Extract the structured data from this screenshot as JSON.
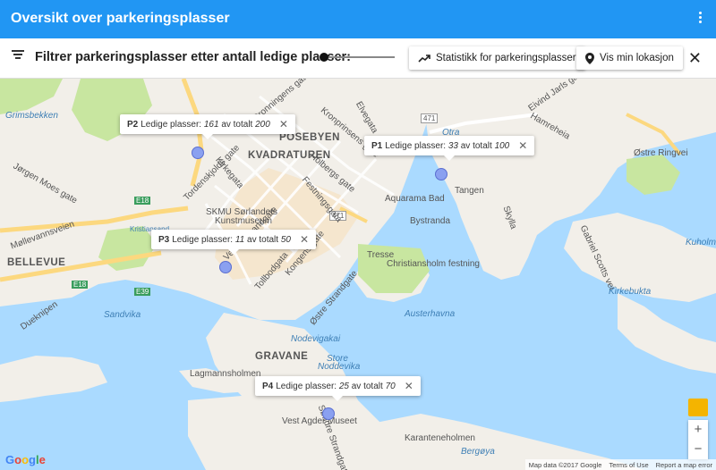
{
  "appbar": {
    "title": "Oversikt over parkeringsplasser"
  },
  "toolbar": {
    "filter_label": "Filtrer parkeringsplasser etter antall ledige plasser:",
    "slider_value": 0,
    "stats_label": "Statistikk for parkeringsplasser",
    "location_label": "Vis min lokasjon"
  },
  "map": {
    "labels": {
      "posebyen": "POSEBYEN",
      "kvadraturen": "KVADRATUREN",
      "bellevue": "BELLEVUE",
      "gravane": "GRAVANE",
      "grimsbekken": "Grimsbekken",
      "skmu1": "SKMU Sørlandets",
      "skmu2": "Kunstmuseum",
      "aquarama": "Aquarama Bad",
      "bystranda": "Bystranda",
      "christiansholm": "Christiansholm festning",
      "tresse": "Tresse",
      "tangen": "Tangen",
      "otra": "Otra",
      "austerhavna": "Austerhavna",
      "sandvika": "Sandvika",
      "lagmannsholmen": "Lagmannsholmen",
      "vestagder": "Vest Agder Museet",
      "karantene": "Karanteneholmen",
      "bergoya": "Bergøya",
      "kuholmsv": "Kuholmsv.",
      "kirkebukta": "Kirkebukta",
      "nodevigakai": "Nodevigakai",
      "store": "Store",
      "noddevika": "Noddevika",
      "ostrering": "Østre Ringvei",
      "kristiansand": "Kristiansand",
      "e18a": "E18",
      "e18b": "E18",
      "e39": "E39",
      "r471a": "471",
      "r471b": "471",
      "holberg": "Holbergs gate",
      "festning": "Festningsgata",
      "kronprinsens": "Kronprinsens gate",
      "dronningens": "Dronningens gate",
      "elvegata": "Elvegata",
      "tordenskjolds": "Tordenskjolds gate",
      "kirkegata": "Kirkegata",
      "tollbodgata": "Tollbodgata",
      "kongens": "Kongens gate",
      "ostrestrand": "Østre Strandgate",
      "vestrestrand": "Vestre Strandgate",
      "eivind": "Eivind Jarls gate",
      "hamreheia": "Hamreheia",
      "gabriel": "Gabriel Scotts vei",
      "skylla": "Skylla",
      "jergen": "Jørgen Moes gate",
      "mollevann": "Møllevannsveien",
      "dueknipen": "Dueknipen",
      "sodrestrand": "Søndre Strandgate"
    },
    "popups": [
      {
        "id": "P2",
        "prefix": "Ledige plasser:",
        "free": "161",
        "mid": "av totalt",
        "total": "200"
      },
      {
        "id": "P1",
        "prefix": "Ledige plasser:",
        "free": "33",
        "mid": "av totalt",
        "total": "100"
      },
      {
        "id": "P3",
        "prefix": "Ledige plasser:",
        "free": "11",
        "mid": "av totalt",
        "total": "50"
      },
      {
        "id": "P4",
        "prefix": "Ledige plasser:",
        "free": "25",
        "mid": "av totalt",
        "total": "70"
      }
    ],
    "close_glyph": "✕",
    "zoom_in": "+",
    "zoom_out": "−",
    "google": "Google",
    "footer": {
      "mapdata": "Map data ©2017 Google",
      "terms": "Terms of Use",
      "report": "Report a map error"
    },
    "colors": {
      "water": "#aadaff",
      "land": "#f2efe9",
      "park": "#c8e6a0",
      "highway": "#fcd87f",
      "marker": "#8aa0f0"
    }
  }
}
